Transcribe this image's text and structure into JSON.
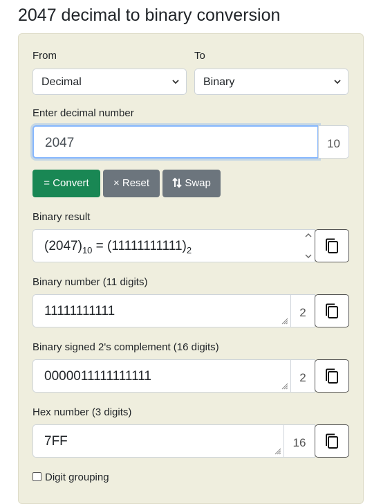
{
  "title": "2047 decimal to binary conversion",
  "from": {
    "label": "From",
    "value": "Decimal"
  },
  "to": {
    "label": "To",
    "value": "Binary"
  },
  "input": {
    "label": "Enter decimal number",
    "value": "2047",
    "base": "10"
  },
  "buttons": {
    "convert": "= Convert",
    "reset": "× Reset",
    "swap": "Swap"
  },
  "binary_result": {
    "label": "Binary result",
    "open1": "(",
    "decimal": "2047",
    "close1": ")",
    "base_from": "10",
    "equals": " = (",
    "binary": "11111111111",
    "close2": ")",
    "base_to": "2"
  },
  "binary_number": {
    "label": "Binary number (11 digits)",
    "value": "11111111111",
    "base": "2"
  },
  "twos_complement": {
    "label": "Binary signed 2's complement (16 digits)",
    "value": "0000011111111111",
    "base": "2"
  },
  "hex_number": {
    "label": "Hex number (3 digits)",
    "value": "7FF",
    "base": "16"
  },
  "digit_grouping": {
    "label": "Digit grouping",
    "checked": false
  },
  "colors": {
    "panel": "#efeede",
    "convert": "#198754",
    "secondary": "#6c757d",
    "focus": "#86b7fe"
  },
  "icons": [
    "chevron-down-icon",
    "copy-icon",
    "resize-grip-icon",
    "swap-arrows-icon",
    "spinner-arrows-icon"
  ]
}
